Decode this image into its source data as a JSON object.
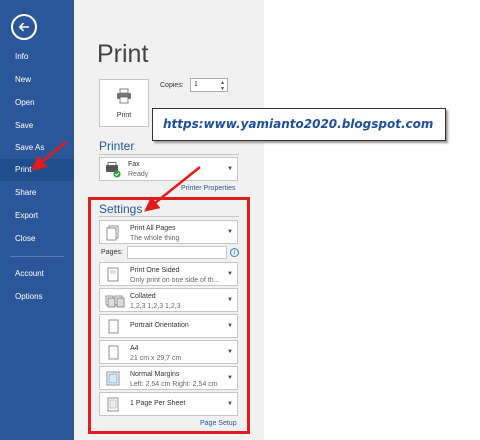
{
  "sidebar": {
    "items": [
      {
        "label": "Info"
      },
      {
        "label": "New"
      },
      {
        "label": "Open"
      },
      {
        "label": "Save"
      },
      {
        "label": "Save As"
      },
      {
        "label": "Print"
      },
      {
        "label": "Share"
      },
      {
        "label": "Export"
      },
      {
        "label": "Close"
      },
      {
        "label": "Account"
      },
      {
        "label": "Options"
      }
    ],
    "active": "Print"
  },
  "main": {
    "title": "Print",
    "print_button_label": "Print",
    "copies_label": "Copies:",
    "copies_value": "1",
    "printer_section": "Printer",
    "printer": {
      "name": "Fax",
      "status": "Ready"
    },
    "printer_properties": "Printer Properties",
    "settings_section": "Settings",
    "pages_label": "Pages:",
    "settings": [
      {
        "line1": "Print All Pages",
        "line2": "The whole thing",
        "icon": "pages-icon"
      },
      {
        "line1": "Print One Sided",
        "line2": "Only print on one side of th...",
        "icon": "one-sided-icon"
      },
      {
        "line1": "Collated",
        "line2": "1,2,3    1,2,3    1,2,3",
        "icon": "collated-icon"
      },
      {
        "line1": "Portrait Orientation",
        "line2": "",
        "icon": "portrait-icon"
      },
      {
        "line1": "A4",
        "line2": "21 cm x 29,7 cm",
        "icon": "paper-size-icon"
      },
      {
        "line1": "Normal Margins",
        "line2": "Left:  2,54 cm    Right:  2,54 cm",
        "icon": "margins-icon"
      },
      {
        "line1": "1 Page Per Sheet",
        "line2": "",
        "icon": "pages-per-sheet-icon"
      }
    ],
    "page_setup": "Page Setup"
  },
  "overlay": {
    "url": "https:www.yamianto2020.blogspot.com"
  },
  "colors": {
    "sidebar": "#2b579a",
    "accent": "#2b579a",
    "highlight": "#e31b1b"
  }
}
